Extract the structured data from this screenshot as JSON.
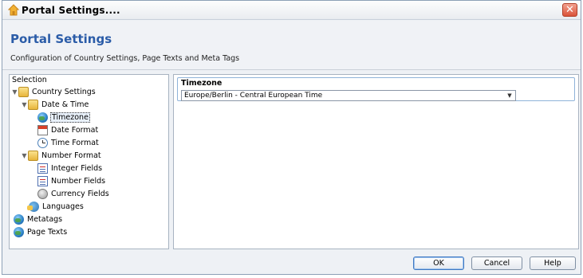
{
  "window": {
    "title": "Portal Settings...."
  },
  "header": {
    "title": "Portal Settings",
    "subtitle": "Configuration of Country Settings, Page Texts and Meta Tags"
  },
  "selection_panel": {
    "title": "Selection",
    "tree": [
      {
        "label": "Country Settings",
        "icon": "folder-icon"
      },
      {
        "label": "Date & Time",
        "icon": "folder-icon"
      },
      {
        "label": "Timezone",
        "icon": "globe-icon",
        "selected": true
      },
      {
        "label": "Date Format",
        "icon": "calendar-icon"
      },
      {
        "label": "Time Format",
        "icon": "clock-icon"
      },
      {
        "label": "Number Format",
        "icon": "folder-icon"
      },
      {
        "label": "Integer Fields",
        "icon": "document-icon"
      },
      {
        "label": "Number Fields",
        "icon": "document-icon"
      },
      {
        "label": "Currency Fields",
        "icon": "coin-icon"
      },
      {
        "label": "Languages",
        "icon": "language-icon"
      },
      {
        "label": "Metatags",
        "icon": "globe-icon"
      },
      {
        "label": "Page Texts",
        "icon": "globe-icon"
      }
    ]
  },
  "timezone": {
    "label": "Timezone",
    "selected_value": "Europe/Berlin - Central European Time"
  },
  "buttons": {
    "ok": "OK",
    "cancel": "Cancel",
    "help": "Help"
  },
  "colors": {
    "header_title": "#2b5ca8",
    "close_button": "#d9533a"
  }
}
